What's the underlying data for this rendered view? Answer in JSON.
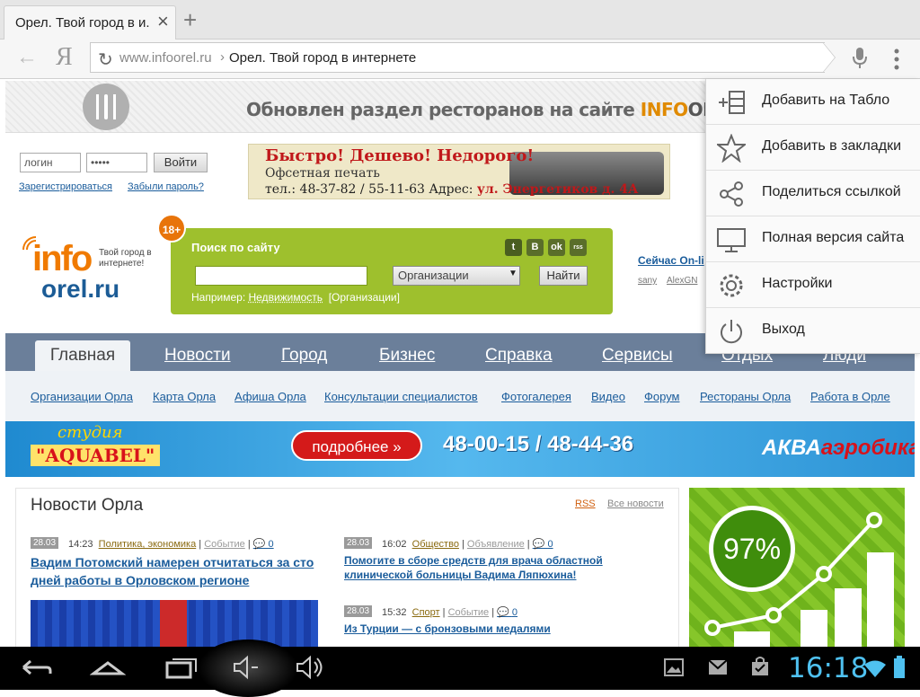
{
  "tab": {
    "title": "Орел. Твой город в и...",
    "close": "×",
    "new": "+"
  },
  "toolbar": {
    "back": "←",
    "yandex": "Я",
    "reload": "↻",
    "url_domain": "www.infoorel.ru",
    "url_sep": "›",
    "url_title": "Орел. Твой город в интернете"
  },
  "top_banner": {
    "text": "Обновлен раздел ресторанов на сайте ",
    "brand_info": "INFO",
    "brand_rest": "OREL.RU"
  },
  "login": {
    "login_value": "логин",
    "password_value": "•••••",
    "submit": "Войти",
    "register": "Зарегистрироваться",
    "forgot": "Забыли пароль?"
  },
  "print_ad": {
    "title": "Быстро! Дешево! Недорого!",
    "subtitle": "Офсетная печать",
    "phones": "тел.: 48-37-82 / 55-11-63  Адрес: ",
    "address": "ул. Энергетиков д. 4А"
  },
  "logo": {
    "info": "info",
    "orel": "orel.ru",
    "tagline": "Твой город в интернете!"
  },
  "search": {
    "badge": "18+",
    "title": "Поиск по сайту",
    "input_value": "",
    "select_value": "Организации",
    "submit": "Найти",
    "example_prefix": "Например: ",
    "example_link1": "Недвижимость",
    "example_link2": "[Организации]",
    "social": [
      "t",
      "В",
      "ok",
      "rss"
    ]
  },
  "online": {
    "title": "Сейчас On-li",
    "users": [
      "sany",
      "AlexGN"
    ]
  },
  "nav": {
    "active": "Главная",
    "tabs": [
      "Новости",
      "Город",
      "Бизнес",
      "Справка",
      "Сервисы",
      "Отдых",
      "Люди"
    ]
  },
  "subnav": [
    "Организации Орла",
    "Карта Орла",
    "Афиша Орла",
    "Консультации специалистов",
    "Фотогалерея",
    "Видео",
    "Форум",
    "Рестораны Орла",
    "Работа в Орле"
  ],
  "aqua": {
    "studio": "студия",
    "name": "\"AQUABEL\"",
    "button": "подробнее »",
    "phones": "48-00-15 / 48-44-36",
    "logo_a": "АКВА",
    "logo_b": "аэробика"
  },
  "news": {
    "title": "Новости Орла",
    "rss": "RSS",
    "all": "Все новости",
    "items": [
      {
        "date": "28.03",
        "time": "14:23",
        "category": "Политика, экономика",
        "type": "Событие",
        "comments": "0",
        "headline": "Вадим Потомский намерен отчитаться за сто дней работы в Орловском регионе"
      },
      {
        "date": "28.03",
        "time": "16:02",
        "category": "Общество",
        "type": "Объявление",
        "comments": "0",
        "headline": "Помогите в сборе средств для врача областной клинической больницы Вадима Ляпюхина!"
      },
      {
        "date": "28.03",
        "time": "15:32",
        "category": "Спорт",
        "type": "Событие",
        "comments": "0",
        "headline": "Из Турции — с бронзовыми медалями"
      }
    ]
  },
  "green_ad": {
    "percent": "97%"
  },
  "overflow_menu": [
    {
      "icon": "add-to-dashboard-icon",
      "label": "Добавить на Табло"
    },
    {
      "icon": "star-icon",
      "label": "Добавить в закладки"
    },
    {
      "icon": "share-icon",
      "label": "Поделиться ссылкой"
    },
    {
      "icon": "monitor-icon",
      "label": "Полная версия сайта"
    },
    {
      "icon": "gear-icon",
      "label": "Настройки"
    },
    {
      "icon": "power-icon",
      "label": "Выход"
    }
  ],
  "system": {
    "clock": "16:18"
  },
  "colors": {
    "accent": "#4fc1f0",
    "nav": "#6b7f9a",
    "search_panel": "#9ec02d",
    "brand_orange": "#f07a00",
    "brand_blue": "#1c5c96"
  }
}
